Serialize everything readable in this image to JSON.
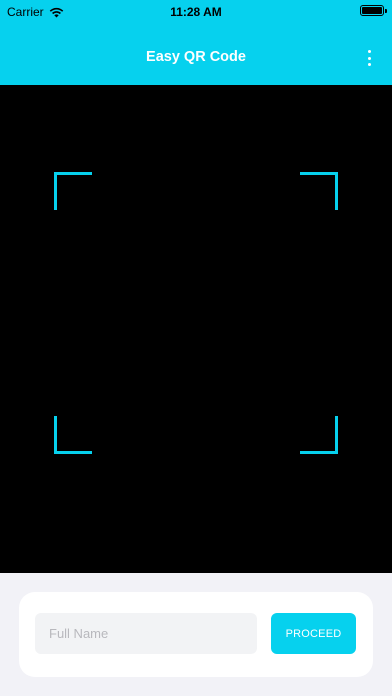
{
  "status_bar": {
    "carrier": "Carrier",
    "wifi_icon": "wifi-icon",
    "time": "11:28 AM",
    "battery_icon": "battery-icon"
  },
  "nav_bar": {
    "title": "Easy QR Code",
    "menu_icon": "more-vertical-icon",
    "background": "#06d1ee"
  },
  "scanner": {
    "frame_color": "#06d1ee",
    "background": "#000000"
  },
  "form": {
    "name_placeholder": "Full Name",
    "name_value": "",
    "proceed_label": "PROCEED"
  },
  "colors": {
    "accent": "#06d1ee",
    "panel_background": "#f2f2f7"
  }
}
